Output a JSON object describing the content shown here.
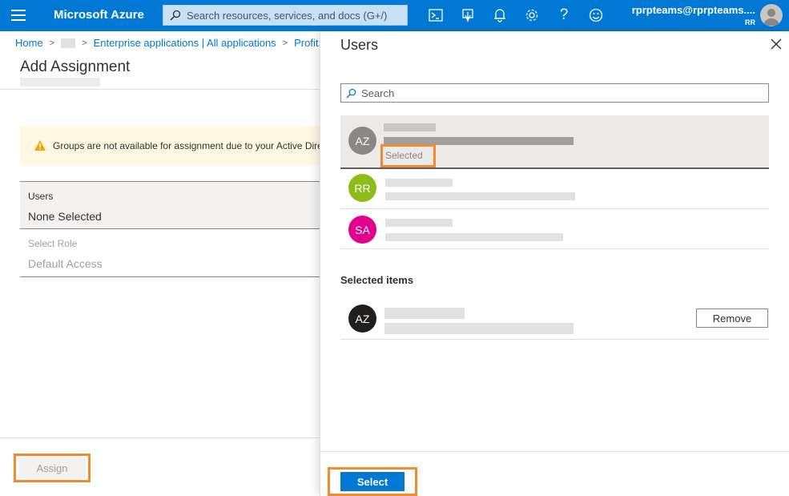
{
  "topbar": {
    "brand": "Microsoft Azure",
    "search_placeholder": "Search resources, services, and docs (G+/)",
    "account_email": "rprpteams@rprpteams....",
    "account_initials": "RR",
    "icons": [
      "cloud-shell-icon",
      "directory-filter-icon",
      "notifications-icon",
      "settings-icon",
      "help-icon",
      "feedback-icon"
    ]
  },
  "breadcrumb": {
    "home": "Home",
    "enterprise": "Enterprise applications | All applications",
    "app": "Profit.co"
  },
  "page": {
    "title": "Add Assignment",
    "warning": "Groups are not available for assignment due to your Active Directory plan level.",
    "users_label": "Users",
    "users_value": "None Selected",
    "role_label": "Select Role",
    "role_value": "Default Access",
    "assign_label": "Assign"
  },
  "blade": {
    "title": "Users",
    "search_placeholder": "Search",
    "users": [
      {
        "initials": "AZ",
        "color": "#8a8886",
        "selected": true,
        "status": "Selected"
      },
      {
        "initials": "RR",
        "color": "#8cbd18",
        "selected": false
      },
      {
        "initials": "SA",
        "color": "#e3008c",
        "selected": false
      }
    ],
    "selected_items_title": "Selected items",
    "selected_item": {
      "initials": "AZ",
      "color": "#201f1e"
    },
    "remove_label": "Remove",
    "select_label": "Select"
  },
  "colors": {
    "accent": "#0078d4",
    "highlight": "#f28a2e",
    "warning": "#d83b01"
  }
}
